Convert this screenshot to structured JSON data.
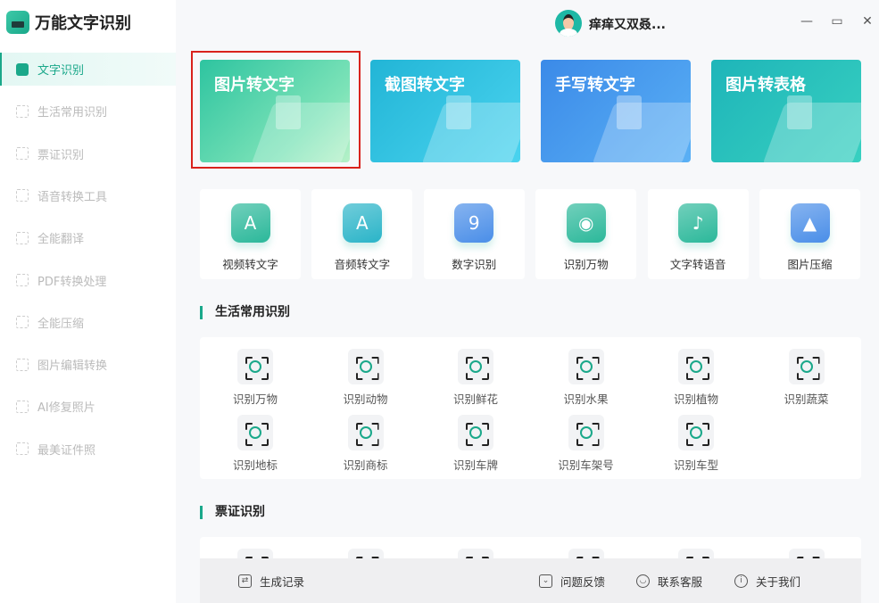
{
  "app": {
    "title": "万能文字识别"
  },
  "user": {
    "name": "痒痒又双叒..."
  },
  "window": {
    "minimize": "—",
    "maximize": "▭",
    "close": "✕"
  },
  "sidebar": {
    "items": [
      {
        "label": "文字识别",
        "active": true
      },
      {
        "label": "生活常用识别"
      },
      {
        "label": "票证识别"
      },
      {
        "label": "语音转换工具"
      },
      {
        "label": "全能翻译"
      },
      {
        "label": "PDF转换处理"
      },
      {
        "label": "全能压缩"
      },
      {
        "label": "图片编辑转换"
      },
      {
        "label": "AI修复照片"
      },
      {
        "label": "最美证件照"
      }
    ]
  },
  "banners": [
    {
      "label": "图片转文字",
      "selected": true
    },
    {
      "label": "截图转文字"
    },
    {
      "label": "手写转文字"
    },
    {
      "label": "图片转表格"
    }
  ],
  "features": [
    {
      "label": "视频转文字",
      "glyph": "A"
    },
    {
      "label": "音频转文字",
      "glyph": "A"
    },
    {
      "label": "数字识别",
      "glyph": "9"
    },
    {
      "label": "识别万物",
      "glyph": "◉"
    },
    {
      "label": "文字转语音",
      "glyph": "♪"
    },
    {
      "label": "图片压缩",
      "glyph": "▲"
    }
  ],
  "life": {
    "title": "生活常用识别",
    "items": [
      {
        "label": "识别万物"
      },
      {
        "label": "识别动物"
      },
      {
        "label": "识别鲜花"
      },
      {
        "label": "识别水果"
      },
      {
        "label": "识别植物"
      },
      {
        "label": "识别蔬菜"
      },
      {
        "label": "识别地标"
      },
      {
        "label": "识别商标"
      },
      {
        "label": "识别车牌"
      },
      {
        "label": "识别车架号"
      },
      {
        "label": "识别车型"
      }
    ]
  },
  "ticket": {
    "title": "票证识别"
  },
  "footer": {
    "history": "生成记录",
    "feedback": "问题反馈",
    "service": "联系客服",
    "about": "关于我们"
  },
  "colors": {
    "accent": "#1aa88a",
    "selection": "#d9221c"
  }
}
